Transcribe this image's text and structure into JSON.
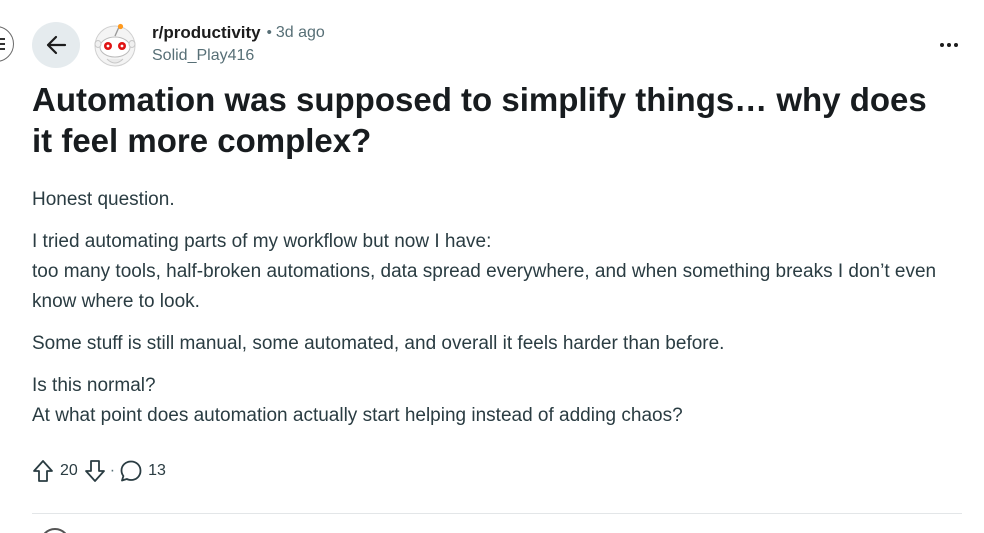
{
  "post": {
    "subreddit": "r/productivity",
    "separator": "•",
    "time": "3d ago",
    "author": "Solid_Play416",
    "title": "Automation was supposed to simplify things… why does it feel more complex?",
    "body": {
      "p1": "Honest question.",
      "p2_line1": "I tried automating parts of my workflow but now I have:",
      "p2_line2": "too many tools, half-broken automations, data spread everywhere, and when something breaks I don’t even know where to look.",
      "p3": "Some stuff is still manual, some automated, and overall it feels harder than before.",
      "p4_line1": "Is this normal?",
      "p4_line2": "At what point does automation actually start helping instead of adding chaos?"
    }
  },
  "actions": {
    "score": "20",
    "separator": "·",
    "comments": "13"
  },
  "icons": {
    "back": "arrow-left-icon",
    "menu": "hamburger-menu-icon",
    "more": "ellipsis-icon",
    "upvote": "upvote-arrow-icon",
    "downvote": "downvote-arrow-icon",
    "comment": "comment-bubble-icon",
    "avatar": "snoo-avatar-icon"
  },
  "colors": {
    "text": "#1c1c1c",
    "muted": "#576f76",
    "back_button_bg": "#e5ebee",
    "avatar_red": "#d93a00"
  }
}
